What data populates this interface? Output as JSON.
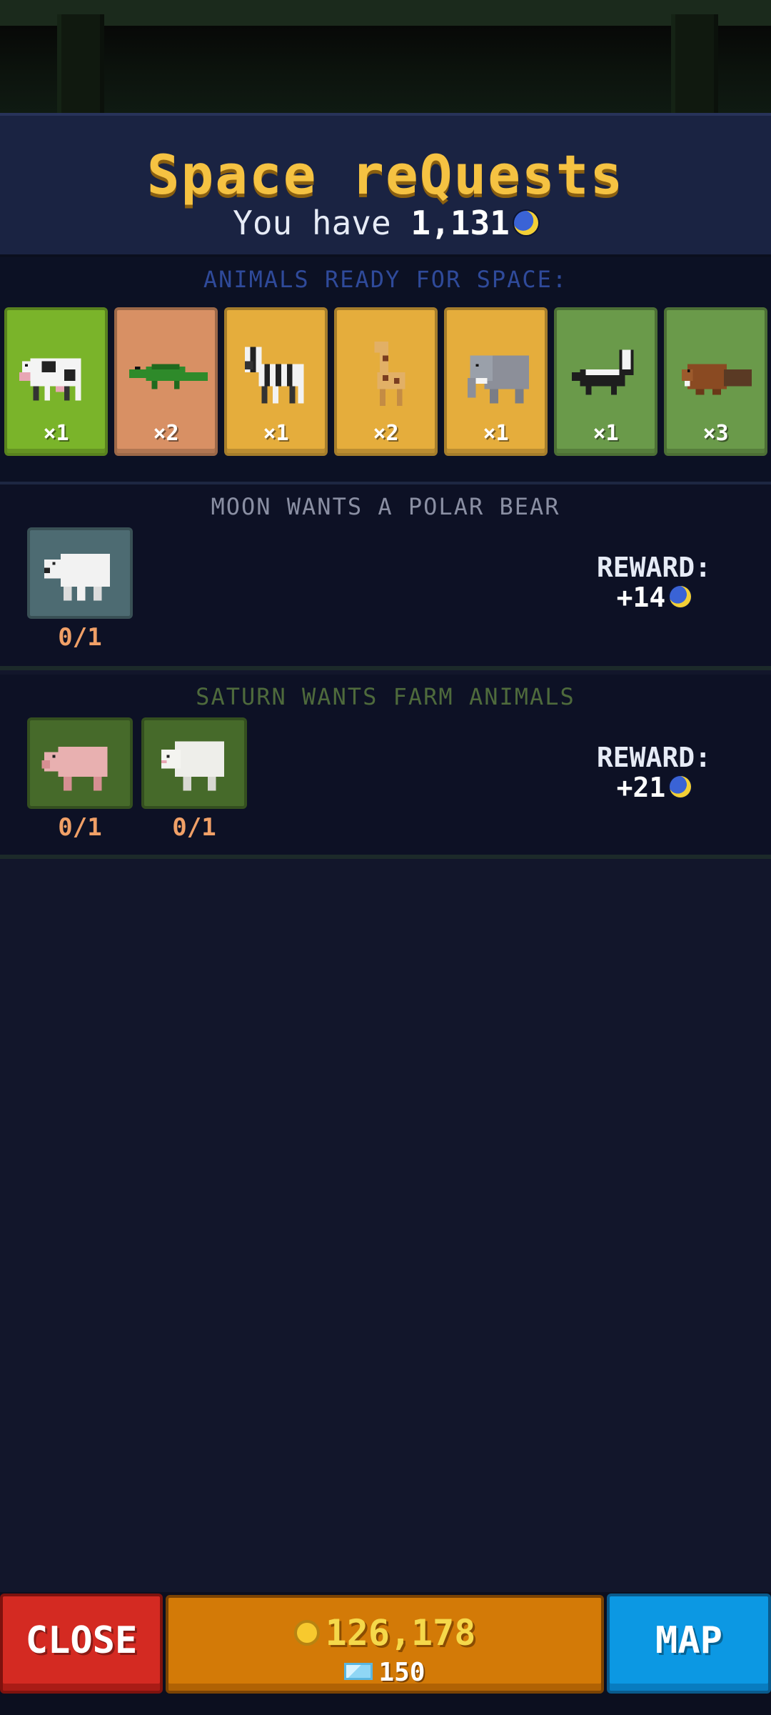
{
  "header": {
    "title": "Space reQuests",
    "balance_prefix": "You have",
    "balance_value": "1,131",
    "token_icon": "moon-token-icon"
  },
  "ready": {
    "label": "ANIMALS READY FOR SPACE:",
    "cards": [
      {
        "animal": "cow",
        "qty": "×1",
        "bg": "#7ab42a"
      },
      {
        "animal": "crocodile",
        "qty": "×2",
        "bg": "#d89064"
      },
      {
        "animal": "zebra",
        "qty": "×1",
        "bg": "#e5ad3c"
      },
      {
        "animal": "giraffe",
        "qty": "×2",
        "bg": "#e5ad3c"
      },
      {
        "animal": "elephant",
        "qty": "×1",
        "bg": "#e5ad3c"
      },
      {
        "animal": "skunk",
        "qty": "×1",
        "bg": "#6a9a4a"
      },
      {
        "animal": "beaver",
        "qty": "×3",
        "bg": "#6a9a4a"
      }
    ]
  },
  "quests": [
    {
      "title": "MOON WANTS A POLAR BEAR",
      "title_color": "#8a8fa3",
      "slots": [
        {
          "animal": "polar-bear",
          "progress": "0/1",
          "bg": "#4d6b72"
        }
      ],
      "reward_label": "REWARD:",
      "reward_value": "+14"
    },
    {
      "title": "SATURN WANTS FARM ANIMALS",
      "title_color": "#4e6a3c",
      "slots": [
        {
          "animal": "pig",
          "progress": "0/1",
          "bg": "#466a2a"
        },
        {
          "animal": "sheep",
          "progress": "0/1",
          "bg": "#466a2a"
        }
      ],
      "reward_label": "REWARD:",
      "reward_value": "+21"
    }
  ],
  "footer": {
    "close_label": "CLOSE",
    "coins": "126,178",
    "gems": "150",
    "map_label": "MAP"
  }
}
